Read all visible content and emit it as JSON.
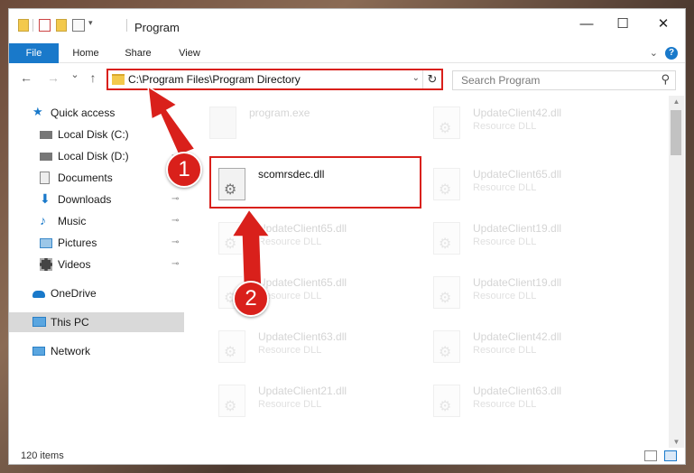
{
  "window": {
    "title": "Program",
    "minimize_glyph": "—",
    "maximize_glyph": "☐",
    "close_glyph": "✕"
  },
  "ribbon": {
    "tabs": [
      "File",
      "Home",
      "Share",
      "View"
    ],
    "help_glyph": "?"
  },
  "nav": {
    "back_glyph": "←",
    "forward_glyph": "→",
    "recent_glyph": "⌄",
    "up_glyph": "↑",
    "address": "C:\\Program Files\\Program Directory",
    "address_dropdown": "⌄",
    "refresh_glyph": "↻",
    "search_placeholder": "Search Program",
    "search_glyph": "⚲"
  },
  "sidebar": {
    "items": [
      {
        "label": "Quick access",
        "icon": "star-icon",
        "color": "#1979ca",
        "pinned": false
      },
      {
        "label": "Local Disk (C:)",
        "icon": "drive-icon",
        "color": "#666666",
        "pinned": true
      },
      {
        "label": "Local Disk (D:)",
        "icon": "drive-icon",
        "color": "#666666",
        "pinned": true
      },
      {
        "label": "Documents",
        "icon": "documents-icon",
        "color": "#8a8a8a",
        "pinned": true
      },
      {
        "label": "Downloads",
        "icon": "downloads-icon",
        "color": "#1979ca",
        "pinned": true
      },
      {
        "label": "Music",
        "icon": "music-icon",
        "color": "#1979ca",
        "pinned": true
      },
      {
        "label": "Pictures",
        "icon": "pictures-icon",
        "color": "#3a88c9",
        "pinned": true
      },
      {
        "label": "Videos",
        "icon": "videos-icon",
        "color": "#555555",
        "pinned": true
      },
      {
        "label": "OneDrive",
        "icon": "cloud-icon",
        "color": "#1979ca",
        "pinned": false
      },
      {
        "label": "This PC",
        "icon": "computer-icon",
        "color": "#2a7fc5",
        "pinned": false
      },
      {
        "label": "Network",
        "icon": "network-icon",
        "color": "#2a7fc5",
        "pinned": false
      }
    ],
    "pin_glyph": "⊸"
  },
  "files": [
    {
      "name": "program.exe",
      "type": ""
    },
    {
      "name": "UpdateClient42.dll",
      "type": "Resource DLL"
    },
    {
      "name": "scomrsdec.dll",
      "type": ""
    },
    {
      "name": "UpdateClient65.dll",
      "type": "Resource DLL"
    },
    {
      "name": "UpdateClient65.dll",
      "type": "Resource DLL"
    },
    {
      "name": "UpdateClient19.dll",
      "type": "Resource DLL"
    },
    {
      "name": "UpdateClient65.dll",
      "type": "Resource DLL"
    },
    {
      "name": "UpdateClient19.dll",
      "type": "Resource DLL"
    },
    {
      "name": "UpdateClient63.dll",
      "type": "Resource DLL"
    },
    {
      "name": "UpdateClient42.dll",
      "type": "Resource DLL"
    },
    {
      "name": "UpdateClient21.dll",
      "type": "Resource DLL"
    },
    {
      "name": "UpdateClient63.dll",
      "type": "Resource DLL"
    }
  ],
  "gear_glyph": "⚙",
  "status": {
    "item_count": "120 items"
  },
  "annotations": {
    "step1": "1",
    "step2": "2",
    "color": "#d9201b"
  }
}
